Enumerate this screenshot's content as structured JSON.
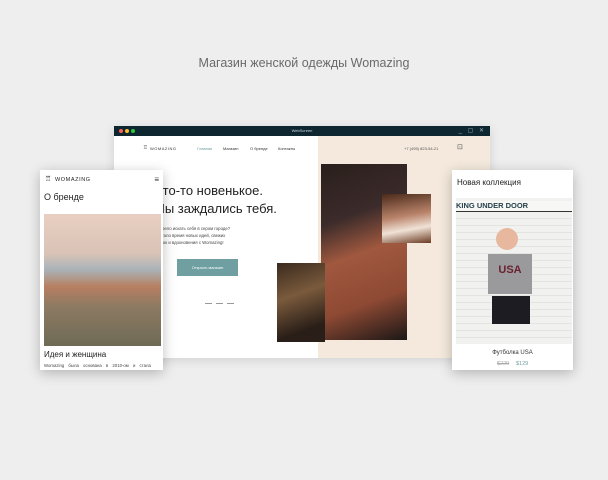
{
  "presentation_title": "Магазин женской одежды Womazing",
  "desktop": {
    "window_title": "WebScreen",
    "window_controls": "_ ▢ ✕",
    "logo": "WOMAZING",
    "nav": [
      "Главная",
      "Магазин",
      "О бренде",
      "Контакты"
    ],
    "phone": "+7 (495) 823-54-21",
    "hero_line1": "Что-то новенькое.",
    "hero_line2": "Мы заждались тебя.",
    "paragraph": [
      "Надоело искать себя в сером городе?",
      "Настало время новых идей, свежих",
      "красок и вдохновения с Womazing!"
    ],
    "cta": "Открыть магазин",
    "arrow": "↓",
    "accent": "#6f9fa1"
  },
  "mobile": {
    "logo": "WOMAZING",
    "heading": "О бренде",
    "subheading": "Идея и женщина",
    "text": "Womazing была основана в 2010-ом и стала"
  },
  "product": {
    "heading": "Новая коллекция",
    "sign": "KING UNDER DOOR",
    "shirt_text": "USA",
    "name": "Футболка USA",
    "old_price": "$229",
    "price": "$129"
  }
}
